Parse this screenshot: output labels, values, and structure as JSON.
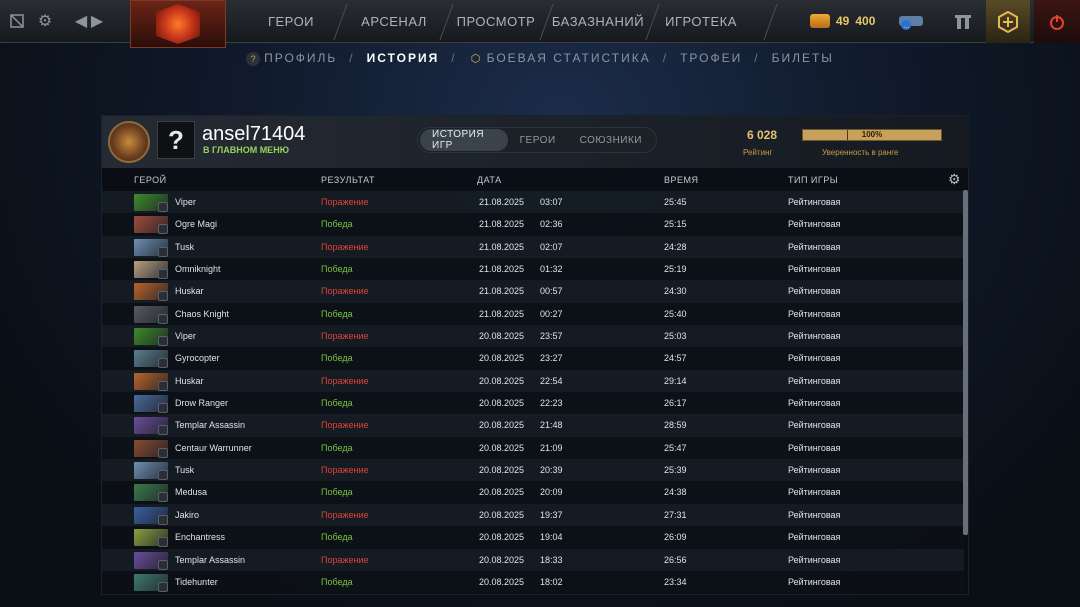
{
  "topbar": {
    "nav": [
      "ГЕРОИ",
      "АРСЕНАЛ",
      "ПРОСМОТР",
      "БАЗАЗНАНИЙ",
      "ИГРОТЕКА"
    ],
    "currency_a": "49",
    "currency_b": "400",
    "icons": [
      "grid-icon",
      "gear-icon",
      "back-arrow-icon",
      "forward-arrow-icon",
      "chat-icon",
      "armory-icon",
      "plus-hex-icon",
      "power-icon"
    ]
  },
  "subnav": {
    "profile": "ПРОФИЛЬ",
    "history": "ИСТОРИЯ",
    "combat": "БОЕВАЯ СТАТИСТИКА",
    "trophies": "ТРОФЕИ",
    "tickets": "БИЛЕТЫ",
    "sep": "/"
  },
  "player": {
    "name": "ansel71404",
    "status": "В ГЛАВНОМ МЕНЮ",
    "avatar": "?"
  },
  "tabs": [
    "ИСТОРИЯ ИГР",
    "ГЕРОИ",
    "СОЮЗНИКИ"
  ],
  "rank": {
    "rating": "6 028",
    "rating_label": "Рейтинг",
    "confidence": "100%",
    "confidence_label": "Уверенность в ранге",
    "confidence_fill": 1.0
  },
  "columns": {
    "hero": "ГЕРОЙ",
    "result": "РЕЗУЛЬТАТ",
    "date": "ДАТА",
    "time": "ВРЕМЯ",
    "type": "ТИП ИГРЫ"
  },
  "matches": [
    {
      "hero": "Viper",
      "result": "Поражение",
      "date": "21.08.2025",
      "clock": "03:07",
      "duration": "25:45",
      "type": "Рейтинговая",
      "color": "#3f8a2c"
    },
    {
      "hero": "Ogre Magi",
      "result": "Победа",
      "date": "21.08.2025",
      "clock": "02:36",
      "duration": "25:15",
      "type": "Рейтинговая",
      "color": "#a04c3a"
    },
    {
      "hero": "Tusk",
      "result": "Поражение",
      "date": "21.08.2025",
      "clock": "02:07",
      "duration": "24:28",
      "type": "Рейтинговая",
      "color": "#6f8fb3"
    },
    {
      "hero": "Omniknight",
      "result": "Победа",
      "date": "21.08.2025",
      "clock": "01:32",
      "duration": "25:19",
      "type": "Рейтинговая",
      "color": "#b7a080"
    },
    {
      "hero": "Huskar",
      "result": "Поражение",
      "date": "21.08.2025",
      "clock": "00:57",
      "duration": "24:30",
      "type": "Рейтинговая",
      "color": "#b8642a"
    },
    {
      "hero": "Chaos Knight",
      "result": "Победа",
      "date": "21.08.2025",
      "clock": "00:27",
      "duration": "25:40",
      "type": "Рейтинговая",
      "color": "#5a5860"
    },
    {
      "hero": "Viper",
      "result": "Поражение",
      "date": "20.08.2025",
      "clock": "23:57",
      "duration": "25:03",
      "type": "Рейтинговая",
      "color": "#3f8a2c"
    },
    {
      "hero": "Gyrocopter",
      "result": "Победа",
      "date": "20.08.2025",
      "clock": "23:27",
      "duration": "24:57",
      "type": "Рейтинговая",
      "color": "#5c7e8c"
    },
    {
      "hero": "Huskar",
      "result": "Поражение",
      "date": "20.08.2025",
      "clock": "22:54",
      "duration": "29:14",
      "type": "Рейтинговая",
      "color": "#b8642a"
    },
    {
      "hero": "Drow Ranger",
      "result": "Победа",
      "date": "20.08.2025",
      "clock": "22:23",
      "duration": "26:17",
      "type": "Рейтинговая",
      "color": "#4a6a9a"
    },
    {
      "hero": "Templar Assassin",
      "result": "Поражение",
      "date": "20.08.2025",
      "clock": "21:48",
      "duration": "28:59",
      "type": "Рейтинговая",
      "color": "#6b4c9a"
    },
    {
      "hero": "Centaur Warrunner",
      "result": "Победа",
      "date": "20.08.2025",
      "clock": "21:09",
      "duration": "25:47",
      "type": "Рейтинговая",
      "color": "#8a4a30"
    },
    {
      "hero": "Tusk",
      "result": "Поражение",
      "date": "20.08.2025",
      "clock": "20:39",
      "duration": "25:39",
      "type": "Рейтинговая",
      "color": "#6f8fb3"
    },
    {
      "hero": "Medusa",
      "result": "Победа",
      "date": "20.08.2025",
      "clock": "20:09",
      "duration": "24:38",
      "type": "Рейтинговая",
      "color": "#3d7a4a"
    },
    {
      "hero": "Jakiro",
      "result": "Поражение",
      "date": "20.08.2025",
      "clock": "19:37",
      "duration": "27:31",
      "type": "Рейтинговая",
      "color": "#3b5fa0"
    },
    {
      "hero": "Enchantress",
      "result": "Победа",
      "date": "20.08.2025",
      "clock": "19:04",
      "duration": "26:09",
      "type": "Рейтинговая",
      "color": "#8aa040"
    },
    {
      "hero": "Templar Assassin",
      "result": "Поражение",
      "date": "20.08.2025",
      "clock": "18:33",
      "duration": "26:56",
      "type": "Рейтинговая",
      "color": "#6b4c9a"
    },
    {
      "hero": "Tidehunter",
      "result": "Победа",
      "date": "20.08.2025",
      "clock": "18:02",
      "duration": "23:34",
      "type": "Рейтинговая",
      "color": "#3f7a6a"
    }
  ]
}
